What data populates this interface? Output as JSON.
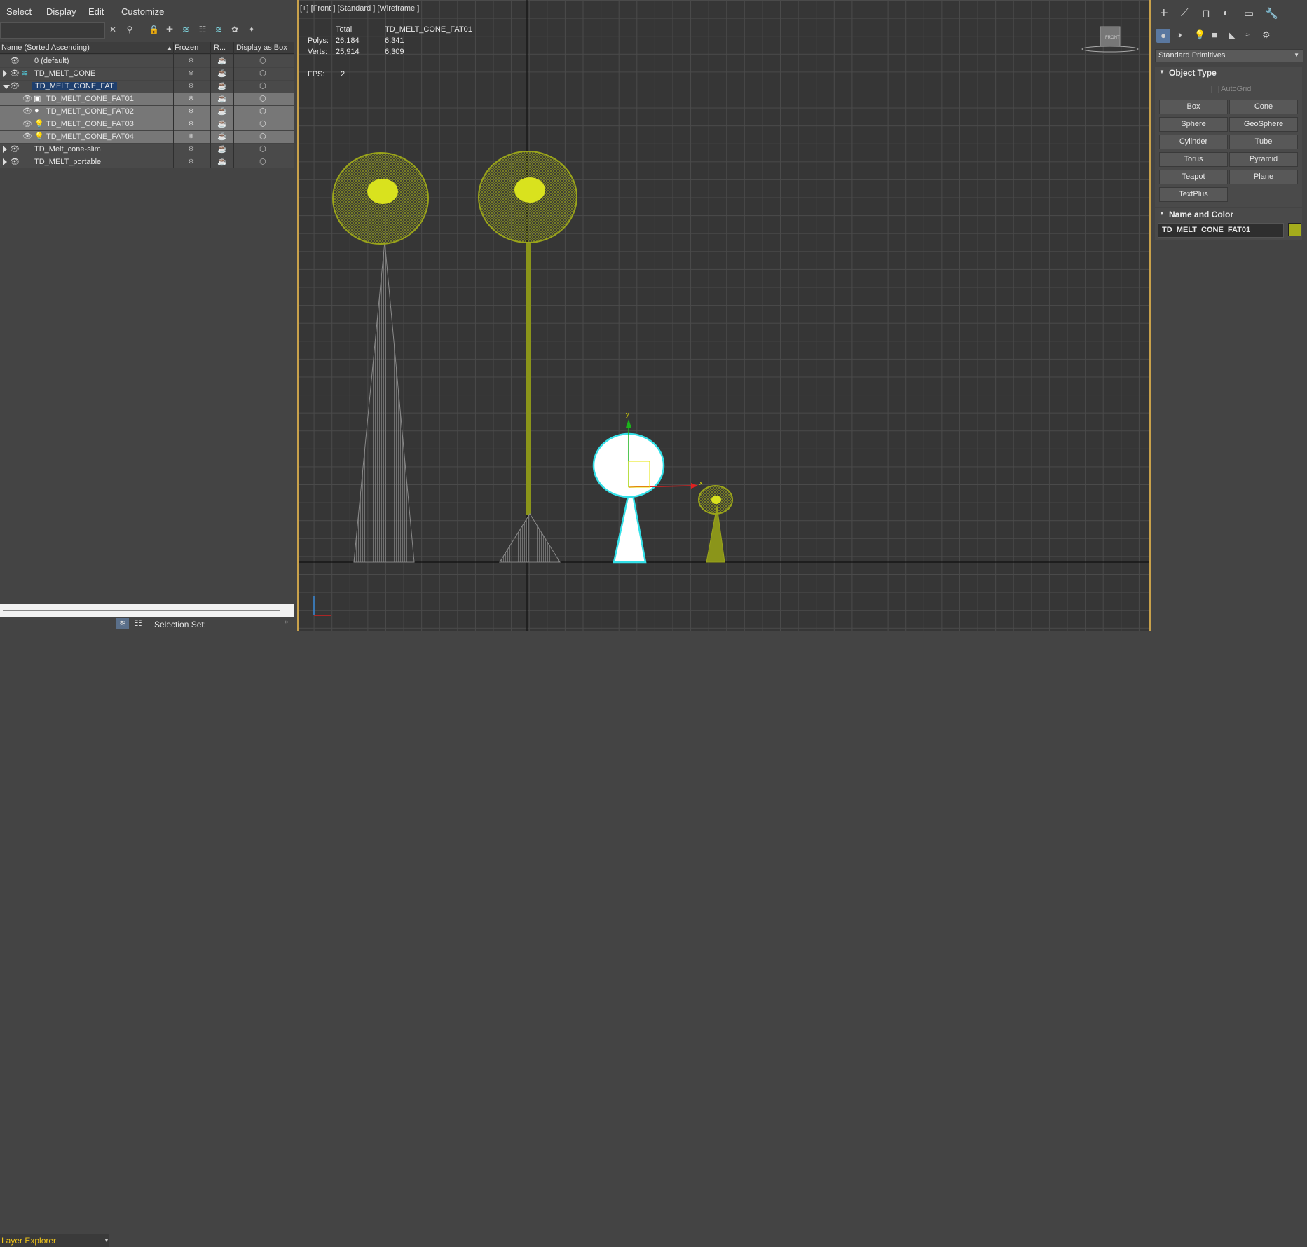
{
  "menu": [
    "Select",
    "Display",
    "Edit",
    "Customize"
  ],
  "layer_table": {
    "headers": {
      "name": "Name (Sorted Ascending)",
      "frozen": "Frozen",
      "render": "R...",
      "display_box": "Display as Box"
    },
    "rows": [
      {
        "label": "0 (default)"
      },
      {
        "label": "TD_MELT_CONE"
      },
      {
        "label": "TD_MELT_CONE_FAT"
      },
      {
        "label": "TD_MELT_CONE_FAT01"
      },
      {
        "label": "TD_MELT_CONE_FAT02"
      },
      {
        "label": "TD_MELT_CONE_FAT03"
      },
      {
        "label": "TD_MELT_CONE_FAT04"
      },
      {
        "label": "TD_Melt_cone-slim"
      },
      {
        "label": "TD_MELT_portable"
      }
    ]
  },
  "bottom": {
    "explorer": "Layer Explorer",
    "selection_set": "Selection Set:"
  },
  "viewport": {
    "label": "[+] [Front ] [Standard ] [Wireframe ]",
    "stats": {
      "total": "Total",
      "object": "TD_MELT_CONE_FAT01",
      "polys_label": "Polys:",
      "polys_total": "26,184",
      "polys_obj": "6,341",
      "verts_label": "Verts:",
      "verts_total": "25,914",
      "verts_obj": "6,309",
      "fps_label": "FPS:",
      "fps": "2"
    },
    "viewcube": "FRONT",
    "gizmo": {
      "x": "x",
      "y": "y"
    }
  },
  "command_panel": {
    "dropdown": "Standard Primitives",
    "object_type": "Object Type",
    "autogrid": "AutoGrid",
    "buttons": [
      "Box",
      "Cone",
      "Sphere",
      "GeoSphere",
      "Cylinder",
      "Tube",
      "Torus",
      "Pyramid",
      "Teapot",
      "Plane",
      "TextPlus"
    ],
    "name_color": "Name and Color",
    "object_name": "TD_MELT_CONE_FAT01",
    "object_color": "#a4ac1c"
  },
  "colors": {
    "accent": "#c8a14b",
    "wire_green": "#9aa41a",
    "selected_white": "#ffffff",
    "selection_cyan": "#33e0e8",
    "layer_highlight": "#1f3f6d"
  }
}
